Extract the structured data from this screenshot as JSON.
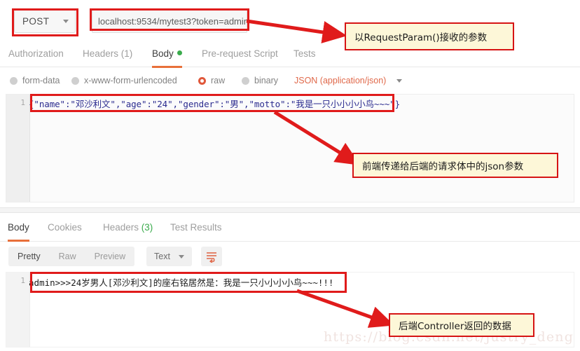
{
  "request": {
    "method": "POST",
    "url": "localhost:9534/mytest3?token=admin",
    "tabs": [
      {
        "label": "Authorization",
        "active": false
      },
      {
        "label": "Headers (1)",
        "active": false
      },
      {
        "label": "Body",
        "active": true,
        "dot": true
      },
      {
        "label": "Pre-request Script",
        "active": false
      },
      {
        "label": "Tests",
        "active": false
      }
    ],
    "body_types": [
      {
        "label": "form-data",
        "selected": false
      },
      {
        "label": "x-www-form-urlencoded",
        "selected": false
      },
      {
        "label": "raw",
        "selected": true
      },
      {
        "label": "binary",
        "selected": false
      }
    ],
    "content_type": "JSON (application/json)",
    "line_number": "1",
    "body_text": "{\"name\":\"邓沙利文\",\"age\":\"24\",\"gender\":\"男\",\"motto\":\"我是一只小小小小鸟~~~\"}"
  },
  "response": {
    "tabs": [
      {
        "label": "Body",
        "active": true
      },
      {
        "label": "Cookies",
        "active": false
      },
      {
        "label": "Headers",
        "count": "(3)",
        "active": false
      },
      {
        "label": "Test Results",
        "active": false
      }
    ],
    "view_modes": [
      {
        "label": "Pretty",
        "active": true
      },
      {
        "label": "Raw",
        "active": false
      },
      {
        "label": "Preview",
        "active": false
      }
    ],
    "format": "Text",
    "wrap_icon": "word-wrap-icon",
    "line_number": "1",
    "body_text": "admin>>>24岁男人[邓沙利文]的座右铭居然是：我是一只小小小小鸟~~~!!!"
  },
  "annotations": {
    "note1": "以RequestParam()接收的参数",
    "note2": "前端传递给后端的请求体中的json参数",
    "note3": "后端Controller返回的数据",
    "highlight_color": "#e01b1b",
    "note_bg": "#fdf7d8"
  },
  "watermark": "https://blog.csdn.net/justry_deng"
}
